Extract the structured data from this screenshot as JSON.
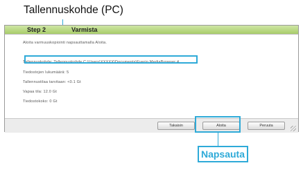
{
  "annotations": {
    "caption": "Tallennuskohde (PC)",
    "click_label": "Napsauta"
  },
  "dialog": {
    "step": "Step 2",
    "step_title": "Varmista",
    "rows": [
      "Aloita varmuuskopiointi napsauttamalla Aloita.",
      "Tallennuskohde: Tallennuskohde C:\\Users\\XXXXX\\Documents\\Everio MediaBrowser 4",
      "Tiedostojen lukumäärä: 5",
      "Tallennustilaa tarvitaan: <0.1 Gt",
      "Vapaa tila: 12.0 Gt",
      "Tiedostokoko: 0 Gt"
    ],
    "buttons": {
      "back": "Takaisin",
      "start": "Aloita",
      "cancel": "Peruuta"
    },
    "colors": {
      "header_green": "#b7d77f",
      "highlight": "#2eaad8"
    }
  }
}
